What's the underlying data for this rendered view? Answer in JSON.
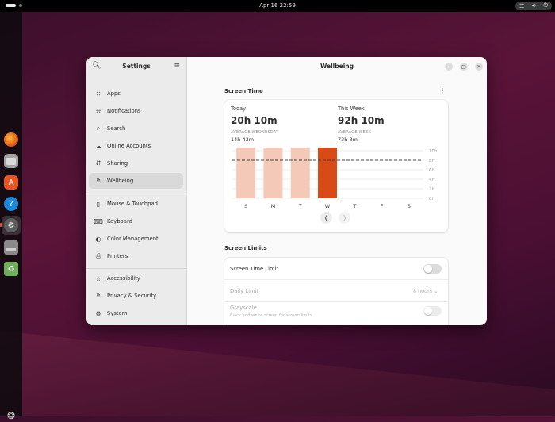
{
  "topbar": {
    "clock": "Apr 16  22:59",
    "tray_icons": [
      "network-icon",
      "volume-icon",
      "power-icon"
    ]
  },
  "dock": {
    "apps": [
      {
        "name": "firefox-icon",
        "color": "#e8650a"
      },
      {
        "name": "files-icon",
        "color": "#9a9a9a"
      },
      {
        "name": "app-center-icon",
        "color": "#e95420"
      },
      {
        "name": "help-icon",
        "color": "#1e88d6"
      },
      {
        "name": "settings-icon",
        "color": "#666666"
      },
      {
        "name": "disk-icon",
        "color": "#888888"
      },
      {
        "name": "trash-icon",
        "color": "#5a9a4a"
      }
    ]
  },
  "sidebar": {
    "title": "Settings",
    "items": [
      {
        "label": "Apps",
        "icon": "grid-icon"
      },
      {
        "label": "Notifications",
        "icon": "bell-icon"
      },
      {
        "label": "Search",
        "icon": "search-icon"
      },
      {
        "label": "Online Accounts",
        "icon": "cloud-icon"
      },
      {
        "label": "Sharing",
        "icon": "share-icon"
      },
      {
        "label": "Wellbeing",
        "icon": "hand-icon",
        "active": true
      },
      {
        "label": "Mouse & Touchpad",
        "icon": "mouse-icon"
      },
      {
        "label": "Keyboard",
        "icon": "keyboard-icon"
      },
      {
        "label": "Color Management",
        "icon": "color-icon"
      },
      {
        "label": "Printers",
        "icon": "printer-icon"
      },
      {
        "label": "Accessibility",
        "icon": "accessibility-icon"
      },
      {
        "label": "Privacy & Security",
        "icon": "hand-icon"
      },
      {
        "label": "System",
        "icon": "gear-icon"
      }
    ]
  },
  "main": {
    "title": "Wellbeing",
    "screen_time": {
      "section_title": "Screen Time",
      "today_label": "Today",
      "today_value": "20h 10m",
      "today_caption": "AVERAGE WEDNESDAY",
      "today_avg": "14h 43m",
      "week_label": "This Week",
      "week_value": "92h 10m",
      "week_caption": "AVERAGE WEEK",
      "week_avg": "73h 3m"
    },
    "screen_limits": {
      "section_title": "Screen Limits",
      "rows": [
        {
          "label": "Screen Time Limit"
        },
        {
          "label": "Daily Limit",
          "value": "8 hours"
        },
        {
          "label": "Grayscale",
          "sub": "Black and white screen for screen limits"
        }
      ]
    }
  },
  "chart_data": {
    "type": "bar",
    "categories": [
      "S",
      "M",
      "T",
      "W",
      "T",
      "F",
      "S"
    ],
    "values": [
      10.5,
      10.5,
      10.5,
      10.5,
      0,
      0,
      0
    ],
    "highlight_index": 3,
    "average_line": 8,
    "y_ticks": [
      "10h",
      "8h",
      "6h",
      "4h",
      "2h",
      "0h"
    ],
    "ylim": [
      0,
      10
    ],
    "colors": {
      "bar": "#f4c9b8",
      "highlight": "#d84a17",
      "average": "#444444"
    }
  }
}
